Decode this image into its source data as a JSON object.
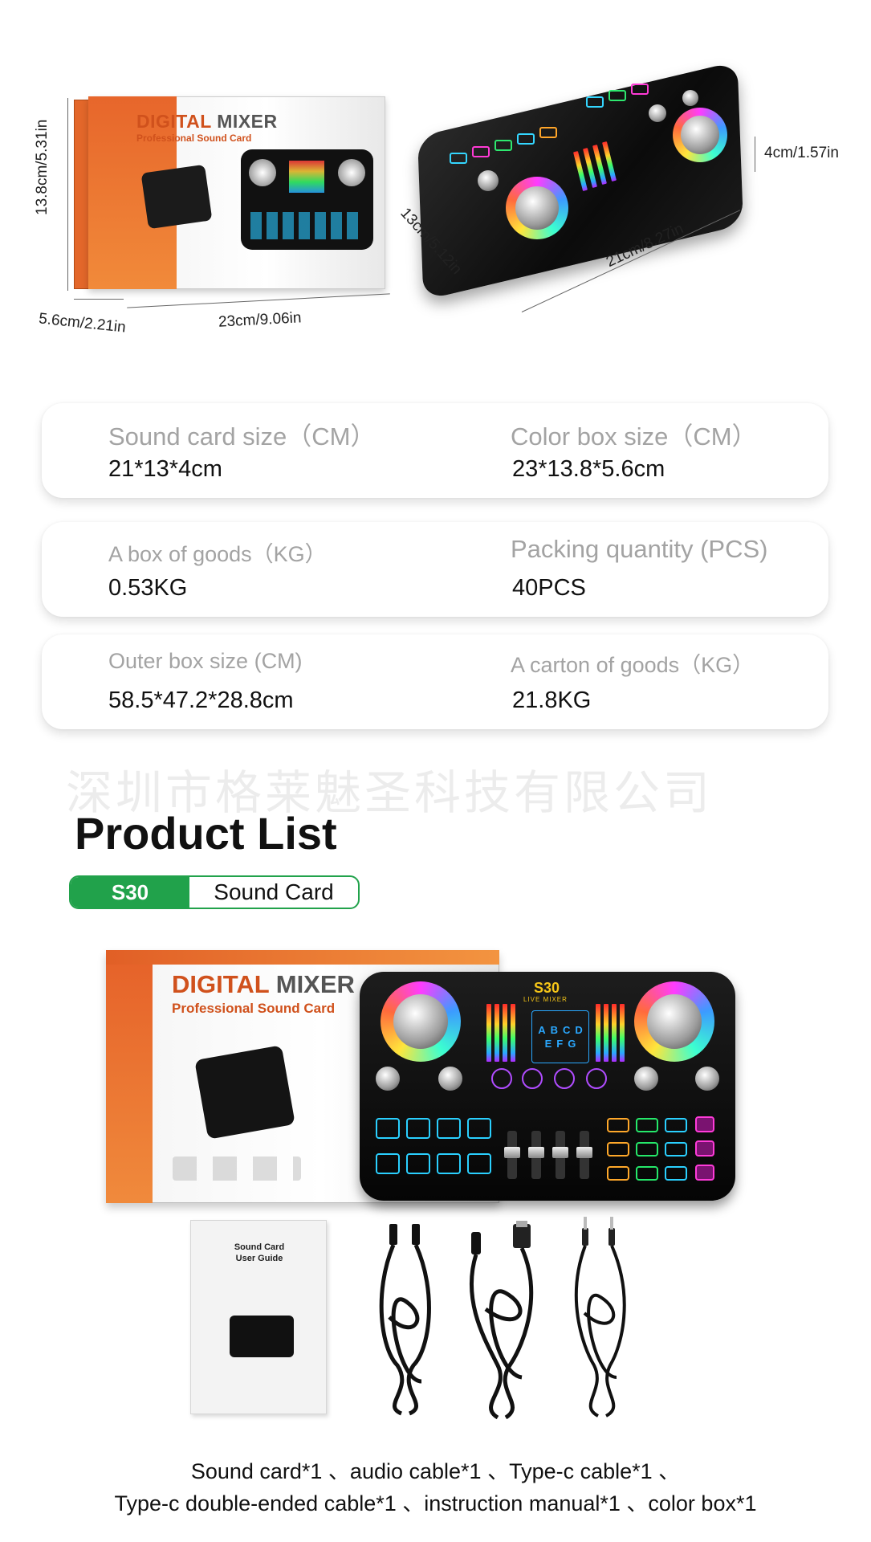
{
  "dimensions": {
    "box_height": "13.8cm/5.31in",
    "box_depth": "5.6cm/2.21in",
    "box_width": "23cm/9.06in",
    "card_depth": "13cm/5.12in",
    "card_width": "21cm/8.27in",
    "card_height": "4cm/1.57in"
  },
  "box_art": {
    "title_a": "DIGITAL ",
    "title_b": "MIXER",
    "subtitle": "Professional Sound Card"
  },
  "specs": [
    {
      "left_label": "Sound card size（CM）",
      "left_value": "21*13*4cm",
      "right_label": "Color box size（CM）",
      "right_value": "23*13.8*5.6cm"
    },
    {
      "left_label": "A  box of goods（KG）",
      "left_value": "0.53KG",
      "right_label": "Packing quantity (PCS)",
      "right_value": "40PCS"
    },
    {
      "left_label": "Outer box size (CM)",
      "left_value": "58.5*47.2*28.8cm",
      "right_label": "A carton of goods（KG）",
      "right_value": "21.8KG"
    }
  ],
  "watermark": "深圳市格莱魅圣科技有限公司",
  "product_list": {
    "title": "Product List",
    "model": "S30",
    "name": "Sound Card"
  },
  "mixer": {
    "model": "S30",
    "subtitle": "LIVE MIXER",
    "screen_letters": [
      "A",
      "B",
      "C",
      "D",
      "E",
      "F",
      "G"
    ]
  },
  "manual": {
    "title_line1": "Sound Card",
    "title_line2": "User Guide"
  },
  "caption": {
    "line1": "Sound card*1 、audio cable*1 、Type-c cable*1 、",
    "line2": "Type-c double-ended cable*1 、instruction manual*1 、color box*1"
  }
}
